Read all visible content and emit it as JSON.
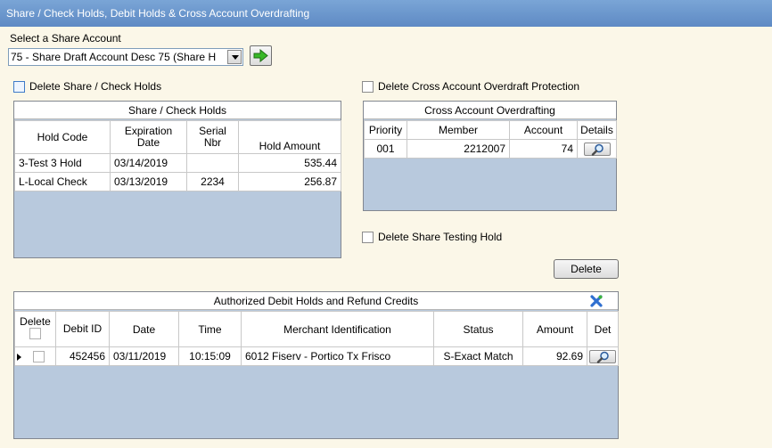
{
  "window": {
    "title": "Share / Check Holds, Debit Holds & Cross Account Overdrafting"
  },
  "share_account": {
    "label": "Select a Share Account",
    "selected": "75 - Share Draft Account Desc 75 (Share H",
    "go_icon": "green-arrow-right-icon"
  },
  "delete_share_check_holds": {
    "label": "Delete Share / Check Holds",
    "checked": false
  },
  "delete_cross_account": {
    "label": "Delete Cross Account Overdraft Protection",
    "checked": false
  },
  "delete_share_testing": {
    "label": "Delete Share Testing Hold",
    "checked": false
  },
  "share_check_holds": {
    "title": "Share / Check Holds",
    "columns": [
      "Hold Code",
      "Expiration Date",
      "Serial Nbr",
      "Hold Amount"
    ],
    "rows": [
      {
        "hold_code": "3-Test 3 Hold",
        "expiration_date": "03/14/2019",
        "serial_nbr": "",
        "hold_amount": "535.44"
      },
      {
        "hold_code": "L-Local Check",
        "expiration_date": "03/13/2019",
        "serial_nbr": "2234",
        "hold_amount": "256.87"
      }
    ]
  },
  "cross_account": {
    "title": "Cross Account Overdrafting",
    "columns": [
      "Priority",
      "Member",
      "Account",
      "Details"
    ],
    "rows": [
      {
        "priority": "001",
        "member": "2212007",
        "account": "74",
        "details_icon": "magnifier-icon"
      }
    ]
  },
  "delete_button": {
    "label": "Delete"
  },
  "debit_holds": {
    "title": "Authorized Debit Holds and Refund Credits",
    "clear_icon": "blue-x-icon",
    "columns": {
      "delete": "Delete",
      "debit_id": "Debit ID",
      "date": "Date",
      "time": "Time",
      "merchant": "Merchant Identification",
      "status": "Status",
      "amount": "Amount",
      "det": "Det"
    },
    "rows": [
      {
        "debit_id": "452456",
        "date": "03/11/2019",
        "time": "10:15:09",
        "merchant": "6012 Fiserv - Portico Tx Frisco",
        "status": "S-Exact Match",
        "amount": "92.69",
        "details_icon": "magnifier-icon"
      }
    ]
  }
}
